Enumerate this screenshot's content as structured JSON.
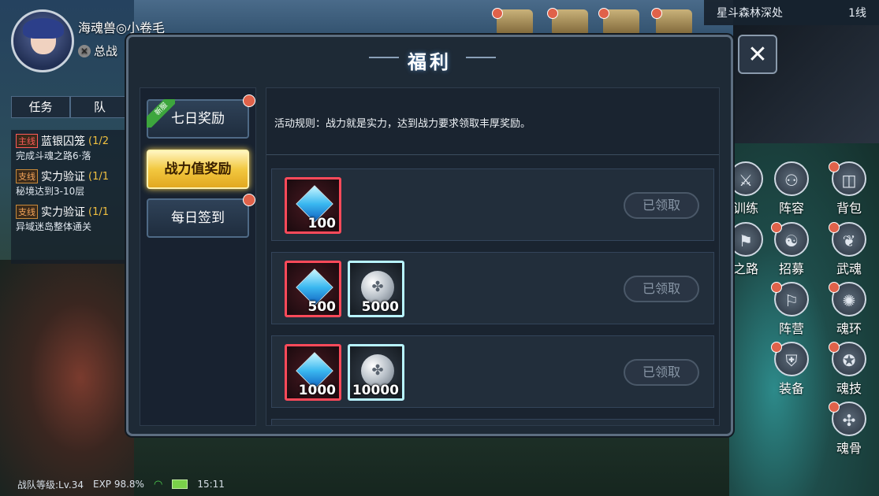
{
  "player": {
    "name": "海魂兽◎小卷毛",
    "power_label": "总战"
  },
  "quest_tabs": [
    "任务",
    "队"
  ],
  "quests": [
    {
      "tag": "主线",
      "title": "蓝银囚笼",
      "progress": "(1/2",
      "desc": "完成斗魂之路6·落"
    },
    {
      "tag": "支线",
      "title": "实力验证",
      "progress": "(1/1",
      "desc": "秘境达到3-10层"
    },
    {
      "tag": "支线",
      "title": "实力验证",
      "progress": "(1/1",
      "desc": "异域迷岛整体通关"
    }
  ],
  "status_bar": {
    "team_level": "战队等级:Lv.34",
    "exp": "EXP 98.8%",
    "time": "15:11"
  },
  "location": {
    "name": "星斗森林深处",
    "line": "1线"
  },
  "side_buttons": [
    "训练",
    "阵容",
    "背包",
    "之路",
    "招募",
    "武魂",
    "阵营",
    "魂环",
    "装备",
    "魂技",
    "魂骨"
  ],
  "modal": {
    "title": "福利",
    "close_symbol": "✕",
    "menu": [
      {
        "label": "七日奖励",
        "badge": "新服"
      },
      {
        "label": "战力值奖励"
      },
      {
        "label": "每日签到"
      }
    ],
    "rules": "活动规则：战力就是实力，达到战力要求领取丰厚奖励。",
    "rewards": [
      {
        "items": [
          "100"
        ],
        "button": "已领取"
      },
      {
        "items": [
          "500",
          "5000"
        ],
        "button": "已领取"
      },
      {
        "items": [
          "1000",
          "10000"
        ],
        "button": "已领取"
      }
    ]
  }
}
